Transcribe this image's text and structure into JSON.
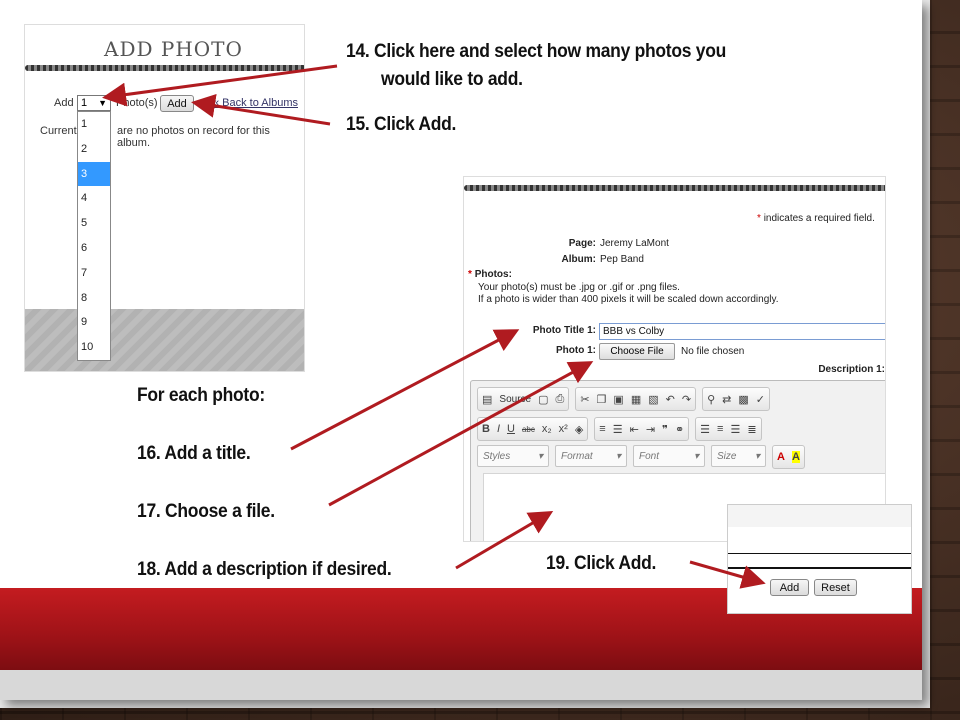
{
  "add_photo_panel": {
    "title": "ADD PHOTO",
    "add_label": "Add",
    "select_value": "1",
    "photos_label": "Photo(s)",
    "add_button": "Add",
    "back_link": "« Back to Albums",
    "current_prefix": "Current",
    "no_photos_msg": "are no photos on record for this album.",
    "dropdown_options": [
      "1",
      "2",
      "3",
      "4",
      "5",
      "6",
      "7",
      "8",
      "9",
      "10"
    ],
    "selected_option": "3"
  },
  "steps": {
    "step14_line1": "14.  Click here and select how many photos you",
    "step14_line2": "would like to add.",
    "step15": "15.  Click Add.",
    "for_each": "For each photo:",
    "step16": "16.  Add a title.",
    "step17": "17.   Choose a file.",
    "step18": "18.  Add a description if desired.",
    "step19": "19.  Click Add."
  },
  "form_panel": {
    "required_note": "indicates a required field.",
    "required_star": "*",
    "page_label": "Page:",
    "page_value": "Jeremy LaMont",
    "album_label": "Album:",
    "album_value": "Pep Band",
    "photos_label": "Photos:",
    "photos_note1": "Your photo(s) must be .jpg or .gif or .png files.",
    "photos_note2": "If a photo is wider than 400 pixels it will be scaled down accordingly.",
    "title_label": "Photo Title 1:",
    "title_value": "BBB vs Colby",
    "photo_label": "Photo 1:",
    "choose_file": "Choose File",
    "no_file": "No file chosen",
    "description_label": "Description 1:",
    "toolbar": {
      "source": "Source",
      "styles": "Styles",
      "format": "Format",
      "font": "Font",
      "size": "Size"
    }
  },
  "submit_panel": {
    "add_button": "Add",
    "reset_button": "Reset"
  },
  "colors": {
    "arrow": "#b01b20",
    "red_band": "#b3181d",
    "selected_option": "#3399ff"
  }
}
